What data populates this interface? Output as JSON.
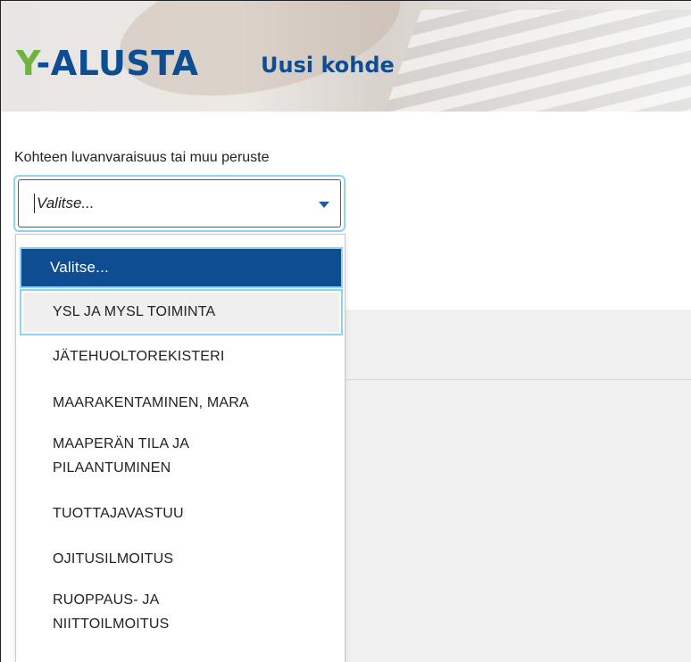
{
  "header": {
    "brand_y": "Y",
    "brand_rest": "-ALUSTA",
    "subtitle": "Uusi kohde"
  },
  "field": {
    "label": "Kohteen luvanvaraisuus tai muu peruste",
    "value": "Valitse..."
  },
  "dropdown": {
    "options": [
      {
        "label": "Valitse..."
      },
      {
        "label": "YSL JA MYSL TOIMINTA"
      },
      {
        "label": "JÄTEHUOLTOREKISTERI"
      },
      {
        "label": "MAARAKENTAMINEN, MARA"
      },
      {
        "label": "MAAPERÄN TILA JA",
        "label2": "PILAANTUMINEN"
      },
      {
        "label": "TUOTTAJAVASTUU"
      },
      {
        "label": "OJITUSILMOITUS"
      },
      {
        "label": "RUOPPAUS- JA",
        "label2": "NIITTOILMOITUS"
      }
    ]
  },
  "colors": {
    "brand_green": "#6fb23f",
    "brand_blue": "#0f4d92",
    "focus_ring": "#8fd3f0",
    "hover_bg": "#efefef"
  },
  "icons": {
    "select_caret": "caret-down-icon"
  }
}
